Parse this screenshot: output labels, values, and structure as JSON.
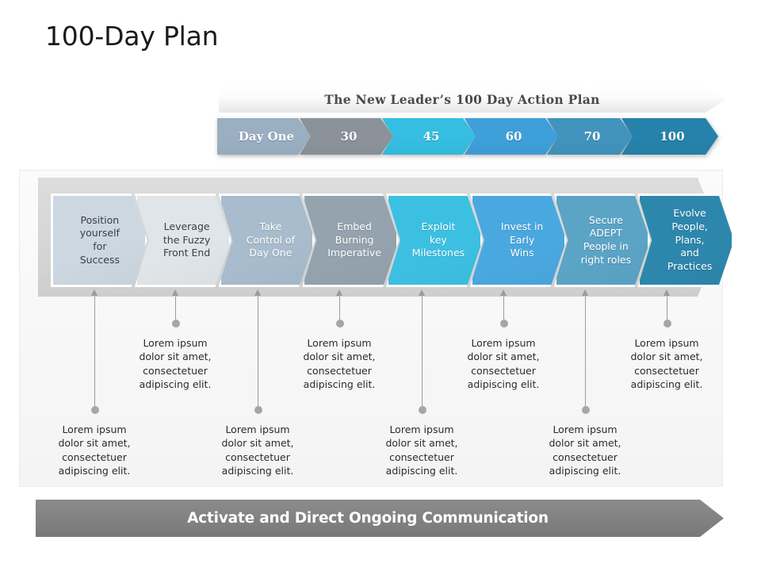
{
  "slide": {
    "title": "100-Day Plan"
  },
  "header_banner": {
    "text": "The New Leader’s 100 Day Action Plan"
  },
  "day_bar": {
    "items": [
      {
        "label": "Day One",
        "color": "#9aafc2"
      },
      {
        "label": "30",
        "color": "#8b9299"
      },
      {
        "label": "45",
        "color": "#35bee1"
      },
      {
        "label": "60",
        "color": "#3e9fd9"
      },
      {
        "label": "70",
        "color": "#4293bd"
      },
      {
        "label": "100",
        "color": "#2682ab"
      }
    ]
  },
  "stages": [
    {
      "label": "Position\nyourself\nfor\nSuccess",
      "color": "#ccd7e2",
      "text_style": "dark"
    },
    {
      "label": "Leverage\nthe Fuzzy\nFront End",
      "color": "#dfe5e9",
      "text_style": "dark"
    },
    {
      "label": "Take\nControl of\nDay One",
      "color": "#a8bccd",
      "text_style": "light"
    },
    {
      "label": "Embed\nBurning\nImperative",
      "color": "#94a3ad",
      "text_style": "light"
    },
    {
      "label": "Exploit\nkey\nMilestones",
      "color": "#3cc0e2",
      "text_style": "light"
    },
    {
      "label": "Invest in\nEarly\nWins",
      "color": "#4aa8e0",
      "text_style": "light"
    },
    {
      "label": "Secure\nADEPT\nPeople in\nright roles",
      "color": "#5ba4c6",
      "text_style": "light"
    },
    {
      "label": "Evolve\nPeople,\nPlans,\nand\nPractices",
      "color": "#2d87ad",
      "text_style": "light"
    }
  ],
  "callouts": [
    {
      "text": "Lorem  ipsum\ndolor  sit amet,\nconsectetuer\nadipiscing  elit.",
      "row": "lower"
    },
    {
      "text": "Lorem  ipsum\ndolor  sit amet,\nconsectetuer\nadipiscing  elit.",
      "row": "upper"
    },
    {
      "text": "Lorem  ipsum\ndolor  sit amet,\nconsectetuer\nadipiscing  elit.",
      "row": "lower"
    },
    {
      "text": "Lorem  ipsum\ndolor  sit amet,\nconsectetuer\nadipiscing  elit.",
      "row": "upper"
    },
    {
      "text": "Lorem  ipsum\ndolor  sit amet,\nconsectetuer\nadipiscing  elit.",
      "row": "lower"
    },
    {
      "text": "Lorem  ipsum\ndolor  sit amet,\nconsectetuer\nadipiscing  elit.",
      "row": "upper"
    },
    {
      "text": "Lorem  ipsum\ndolor  sit amet,\nconsectetuer\nadipiscing  elit.",
      "row": "lower"
    },
    {
      "text": "Lorem  ipsum\ndolor  sit amet,\nconsectetuer\nadipiscing  elit.",
      "row": "upper"
    }
  ],
  "footer_banner": {
    "text": "Activate and Direct Ongoing Communication"
  },
  "colors": {
    "card_bg": "#f8f8f8",
    "band_gray": "#d6d6d6",
    "footer_gray": "#828282",
    "connector": "#9b9b9b",
    "dot": "#a6a6a6"
  }
}
